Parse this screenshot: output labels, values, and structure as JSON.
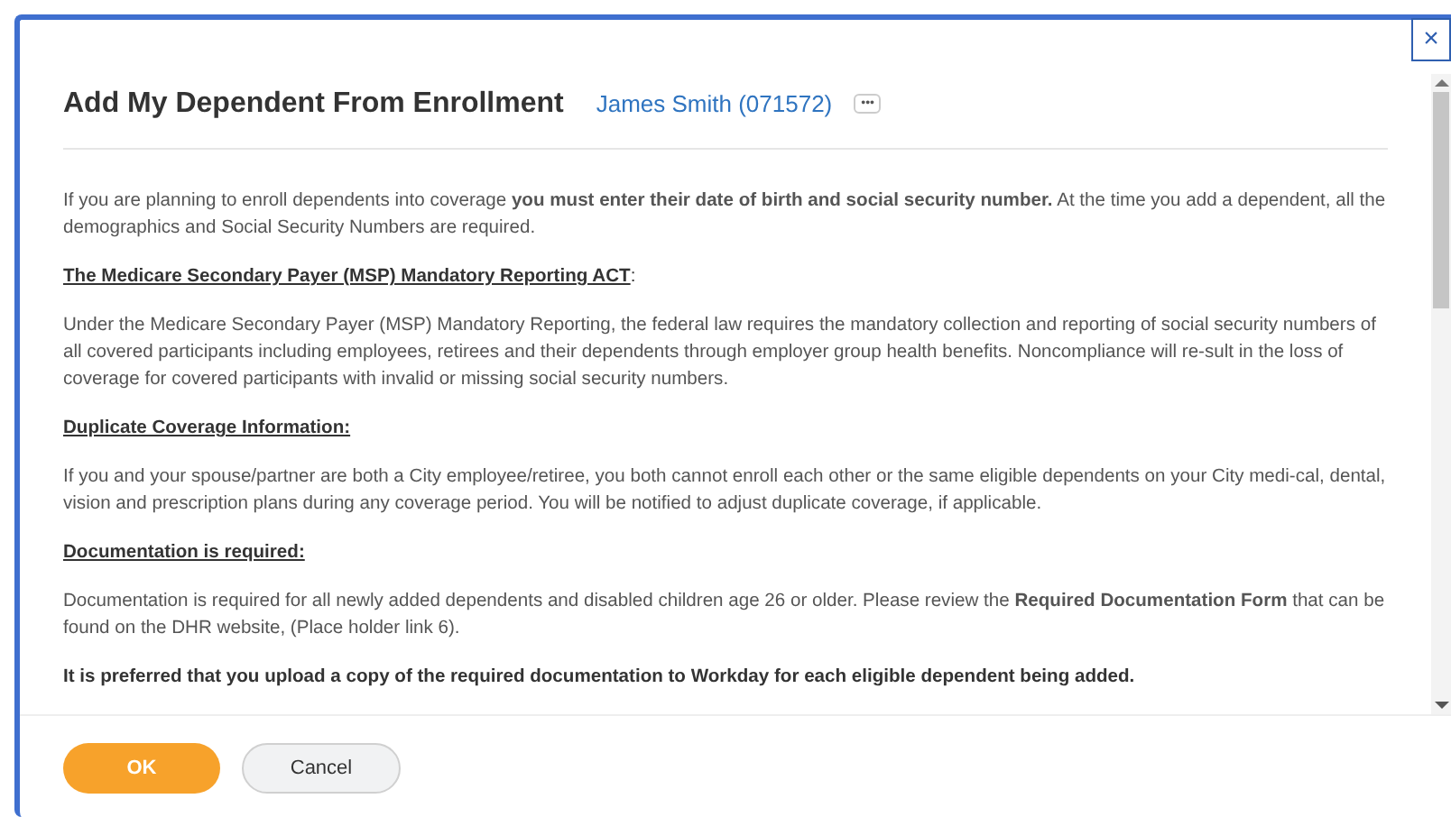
{
  "dialog": {
    "title": "Add My Dependent From Enrollment",
    "worker_link": "James Smith (071572)",
    "more_button": "•••",
    "close_button": "×"
  },
  "sections": [
    {
      "kind": "paragraph",
      "text": "If you are planning to enroll dependents into coverage **you must enter their date of birth and social security number.** At the time you add a dependent, all the demographics and Social Security Numbers are required."
    },
    {
      "kind": "heading",
      "text": "The Medicare Secondary Payer (MSP) Mandatory Reporting ACT",
      "suffix": ":"
    },
    {
      "kind": "paragraph",
      "text": "Under the Medicare Secondary Payer (MSP) Mandatory Reporting, the federal law requires the mandatory collection and reporting of social security numbers of all covered participants including employees, retirees and their dependents through employer group health benefits. Noncompliance will re-sult in the loss of coverage for covered participants with invalid or missing social security numbers."
    },
    {
      "kind": "heading",
      "text": "Duplicate Coverage Information:"
    },
    {
      "kind": "paragraph",
      "text": "If you and your spouse/partner are both a City employee/retiree, you both cannot enroll each other or the same eligible dependents on your City medi-cal, dental, vision and prescription plans during any coverage period.   You will be notified to adjust duplicate coverage, if applicable."
    },
    {
      "kind": "heading",
      "text": "Documentation is required:"
    },
    {
      "kind": "paragraph",
      "text": "Documentation is required for all newly added dependents and disabled children age 26 or older.  Please review the **Required Documentation Form** that can be found on the DHR website, (Place holder link 6)."
    },
    {
      "kind": "strong",
      "text": "It is preferred that you upload a copy of the required documentation to Workday for each eligible dependent being added."
    }
  ],
  "buttons": [
    {
      "label": "OK",
      "kind": "primary"
    },
    {
      "label": "Cancel",
      "kind": "secondary"
    }
  ]
}
